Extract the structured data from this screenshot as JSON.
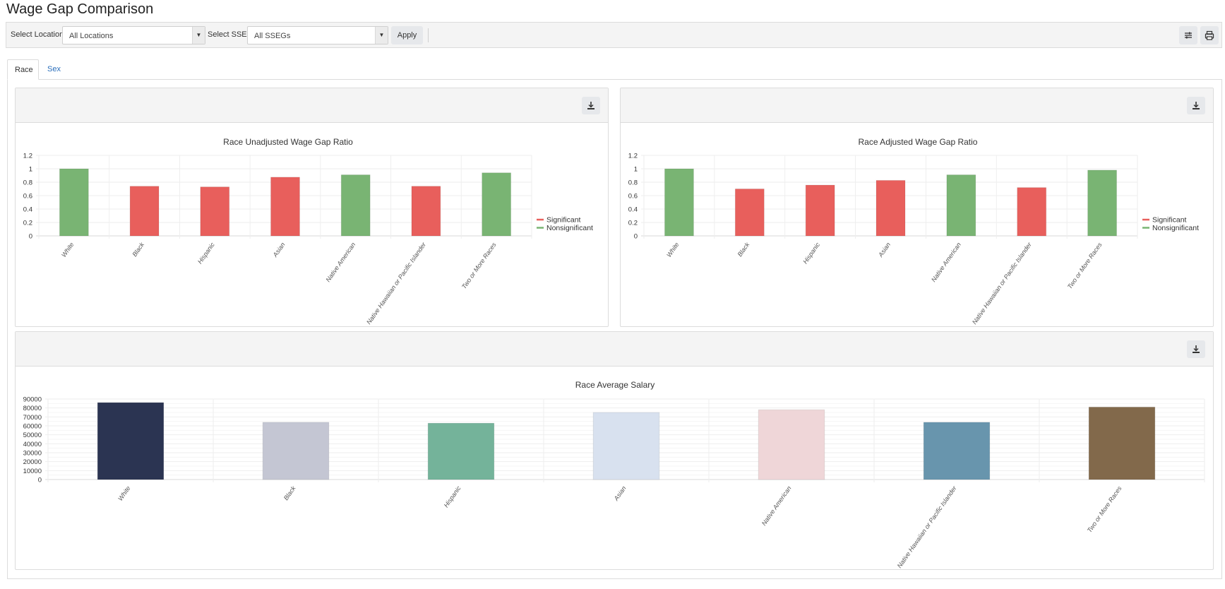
{
  "page": {
    "title": "Wage Gap Comparison"
  },
  "toolbar": {
    "location_label": "Select Location",
    "location_value": "All Locations",
    "sseg_label": "Select SSEG",
    "sseg_value": "All SSEGs",
    "apply_label": "Apply",
    "icons": {
      "settings": "sliders-icon",
      "print": "printer-icon"
    }
  },
  "tabs": [
    {
      "label": "Race",
      "active": true
    },
    {
      "label": "Sex",
      "active": false
    }
  ],
  "colors": {
    "significant": "#e85f5c",
    "nonsignificant": "#79b473"
  },
  "chart_data": [
    {
      "type": "bar",
      "title": "Race Unadjusted Wage Gap Ratio",
      "categories": [
        "White",
        "Black",
        "Hispanic",
        "Asian",
        "Native American",
        "Native Hawaiian or Pacific Islander",
        "Two or More Races"
      ],
      "values": [
        1.0,
        0.74,
        0.73,
        0.875,
        0.91,
        0.74,
        0.94
      ],
      "significance": [
        "Nonsignificant",
        "Significant",
        "Significant",
        "Significant",
        "Nonsignificant",
        "Significant",
        "Nonsignificant"
      ],
      "ylim": [
        0,
        1.2
      ],
      "yticks": [
        "0",
        "0.2",
        "0.4",
        "0.6",
        "0.8",
        "1",
        "1.2"
      ],
      "xlabel": "",
      "ylabel": "",
      "legend": [
        {
          "label": "Significant",
          "color": "#e85f5c"
        },
        {
          "label": "Nonsignificant",
          "color": "#79b473"
        }
      ],
      "legend_position": "right",
      "grid": true
    },
    {
      "type": "bar",
      "title": "Race Adjusted Wage Gap Ratio",
      "categories": [
        "White",
        "Black",
        "Hispanic",
        "Asian",
        "Native American",
        "Native Hawaiian or Pacific Islander",
        "Two or More Races"
      ],
      "values": [
        1.0,
        0.7,
        0.757,
        0.827,
        0.91,
        0.72,
        0.98
      ],
      "significance": [
        "Nonsignificant",
        "Significant",
        "Significant",
        "Significant",
        "Nonsignificant",
        "Significant",
        "Nonsignificant"
      ],
      "ylim": [
        0,
        1.2
      ],
      "yticks": [
        "0",
        "0.2",
        "0.4",
        "0.6",
        "0.8",
        "1",
        "1.2"
      ],
      "xlabel": "",
      "ylabel": "",
      "legend": [
        {
          "label": "Significant",
          "color": "#e85f5c"
        },
        {
          "label": "Nonsignificant",
          "color": "#79b473"
        }
      ],
      "legend_position": "right",
      "grid": true
    },
    {
      "type": "bar",
      "title": "Race Average Salary",
      "categories": [
        "White",
        "Black",
        "Hispanic",
        "Asian",
        "Native American",
        "Native Hawaiian or Pacific Islander",
        "Two or More Races"
      ],
      "values": [
        86000,
        64000,
        63000,
        75000,
        78000,
        64000,
        81000
      ],
      "bar_colors": [
        "#2b3452",
        "#c4c6d3",
        "#74b39a",
        "#d8e1ef",
        "#efd6d8",
        "#6895ad",
        "#82694b"
      ],
      "ylim": [
        0,
        90000
      ],
      "yticks": [
        "0",
        "10000",
        "20000",
        "30000",
        "40000",
        "50000",
        "60000",
        "70000",
        "80000",
        "90000"
      ],
      "xlabel": "",
      "ylabel": "",
      "grid": true
    }
  ]
}
